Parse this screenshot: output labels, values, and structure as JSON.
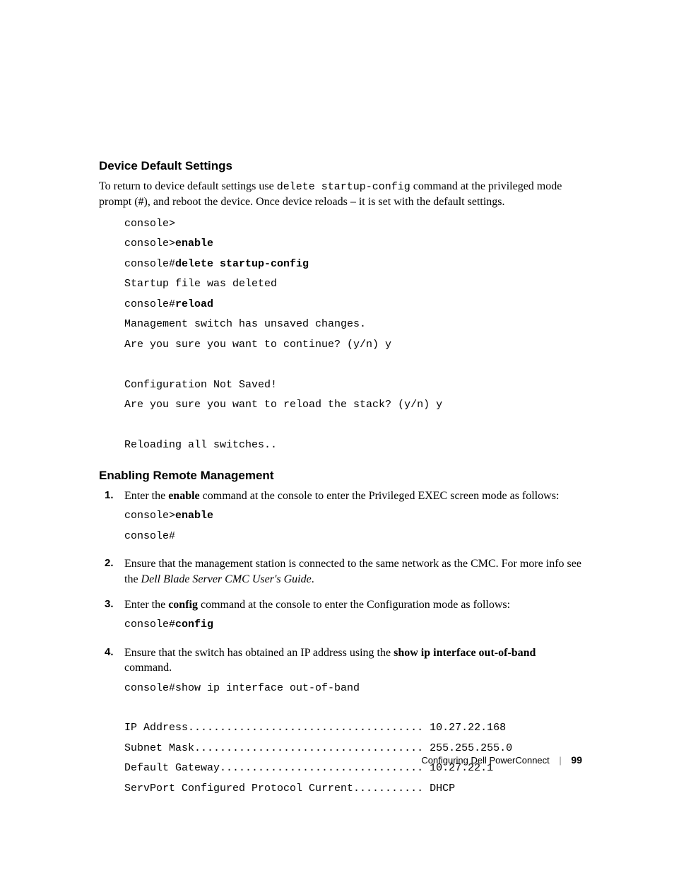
{
  "section1": {
    "heading": "Device Default Settings",
    "para_pre": "To return to device default settings use ",
    "para_cmd": "delete startup-config",
    "para_post": " command at the privileged mode prompt (#), and reboot the device. Once device reloads – it is set with the default settings.",
    "code": {
      "l1": "console>",
      "l2a": "console>",
      "l2b": "enable",
      "l3a": "console#",
      "l3b": "delete startup-config",
      "l4": "Startup file was deleted",
      "l5a": "console#",
      "l5b": "reload",
      "l6": "Management switch has unsaved changes.",
      "l7": "Are you sure you want to continue? (y/n) y",
      "blank1": "",
      "l8": "Configuration Not Saved!",
      "l9": "Are you sure you want to reload the stack? (y/n) y",
      "blank2": "",
      "l10": "Reloading all switches.."
    }
  },
  "section2": {
    "heading": "Enabling Remote Management",
    "steps": {
      "s1": {
        "num": "1.",
        "pre": "Enter the ",
        "cmd": "enable",
        "post": " command at the console to enter the Privileged EXEC screen mode as follows:",
        "code_l1a": "console>",
        "code_l1b": "enable",
        "code_l2": "console#"
      },
      "s2": {
        "num": "2.",
        "pre": "Ensure that the management station is connected to the same network as the CMC. For more info see the ",
        "italic": "Dell Blade Server CMC User's Guide",
        "post": "."
      },
      "s3": {
        "num": "3.",
        "pre": "Enter the ",
        "cmd": "config",
        "post": " command at the console to enter the Configuration mode as follows:",
        "code_l1a": "console#",
        "code_l1b": "config"
      },
      "s4": {
        "num": "4.",
        "pre": "Ensure that the switch has obtained an IP address using the ",
        "cmd": "show ip interface out-of-band",
        "post": " command.",
        "code_l1": "console#show ip interface out-of-band",
        "out_l1": "IP Address..................................... 10.27.22.168",
        "out_l2": "Subnet Mask.................................... 255.255.255.0",
        "out_l3": "Default Gateway................................ 10.27.22.1",
        "out_l4": "ServPort Configured Protocol Current........... DHCP"
      }
    }
  },
  "footer": {
    "title": "Configuring Dell PowerConnect",
    "page": "99"
  }
}
